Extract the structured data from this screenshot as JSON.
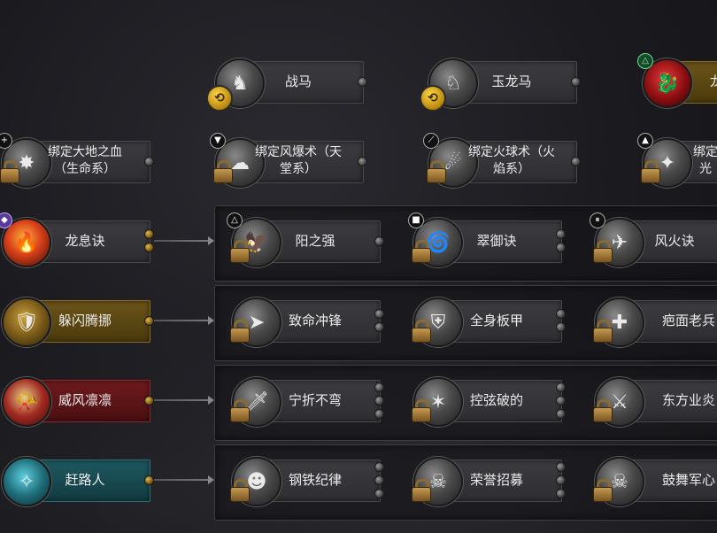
{
  "mounts": [
    {
      "label": "战马",
      "icon": "horse-icon"
    },
    {
      "label": "玉龙马",
      "icon": "jade-dragon-horse-icon"
    },
    {
      "label": "龙",
      "icon": "dragon-icon"
    }
  ],
  "bindings": [
    {
      "label": "绑定大地之血（生命系）",
      "icon": "earth-blood-icon"
    },
    {
      "label": "绑定风爆术（天堂系）",
      "icon": "wind-blast-icon"
    },
    {
      "label": "绑定火球术（火焰系）",
      "icon": "fireball-icon"
    },
    {
      "label": "绑定光",
      "icon": "light-icon"
    }
  ],
  "rows": [
    {
      "skill": "龙息诀",
      "icon": "dragon-breath-icon",
      "children": [
        "阳之强",
        "翠御诀",
        "风火诀"
      ]
    },
    {
      "skill": "躲闪腾挪",
      "icon": "dodge-shield-icon",
      "children": [
        "致命冲锋",
        "全身板甲",
        "疤面老兵"
      ]
    },
    {
      "skill": "威风凛凛",
      "icon": "war-horn-icon",
      "children": [
        "宁折不弯",
        "控弦破的",
        "东方业炎"
      ]
    },
    {
      "skill": "赶路人",
      "icon": "compass-icon",
      "children": [
        "钢铁纪律",
        "荣誉招募",
        "鼓舞军心"
      ]
    }
  ]
}
